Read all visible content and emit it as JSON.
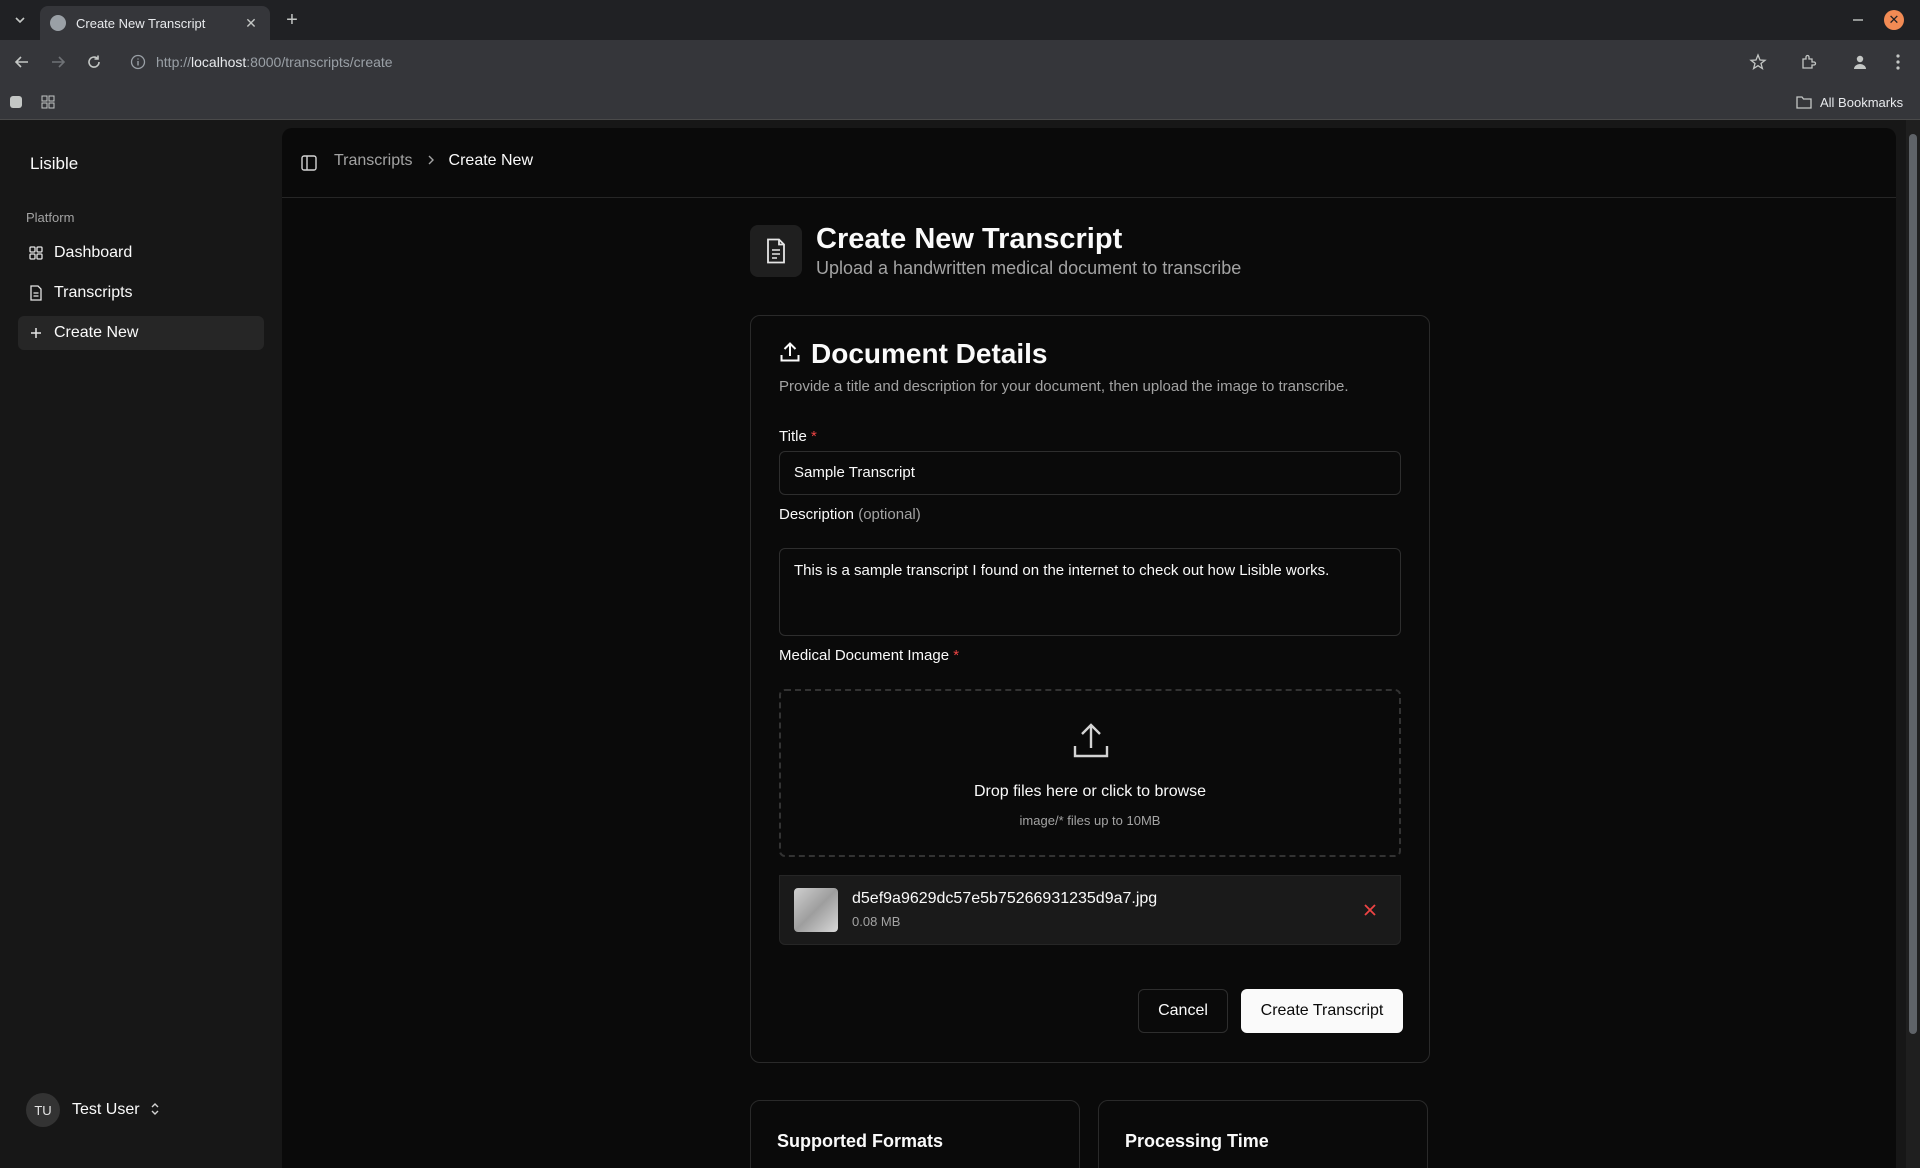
{
  "browser": {
    "tab_title": "Create New Transcript",
    "url_prefix": "http://",
    "url_host": "localhost",
    "url_path": ":8000/transcripts/create",
    "bookmarks_label": "All Bookmarks"
  },
  "sidebar": {
    "brand": "Lisible",
    "group_label": "Platform",
    "items": [
      {
        "label": "Dashboard",
        "icon": "grid-icon"
      },
      {
        "label": "Transcripts",
        "icon": "file-icon"
      },
      {
        "label": "Create New",
        "icon": "plus-icon",
        "active": true
      }
    ],
    "user": {
      "initials": "TU",
      "name": "Test User"
    }
  },
  "header": {
    "breadcrumb": {
      "parent": "Transcripts",
      "current": "Create New"
    }
  },
  "page": {
    "title": "Create New Transcript",
    "subtitle": "Upload a handwritten medical document to transcribe"
  },
  "form": {
    "card_title": "Document Details",
    "card_description": "Provide a title and description for your document, then upload the image to transcribe.",
    "title_label": "Title",
    "required_mark": "*",
    "title_value": "Sample Transcript",
    "description_label": "Description",
    "description_optional": "(optional)",
    "description_value": "This is a sample transcript I found on the internet to check out how Lisible works.",
    "image_label": "Medical Document Image",
    "dropzone_text": "Drop files here or click to browse",
    "dropzone_hint": "image/* files up to 10MB",
    "file": {
      "name": "d5ef9a9629dc57e5b75266931235d9a7.jpg",
      "size": "0.08 MB"
    },
    "cancel_label": "Cancel",
    "submit_label": "Create Transcript"
  },
  "info_cards": [
    {
      "title": "Supported Formats"
    },
    {
      "title": "Processing Time"
    }
  ],
  "colors": {
    "background": "#0a0a0a",
    "sidebar": "#171717",
    "required": "#ef4444",
    "primary_button": "#fafafa"
  }
}
